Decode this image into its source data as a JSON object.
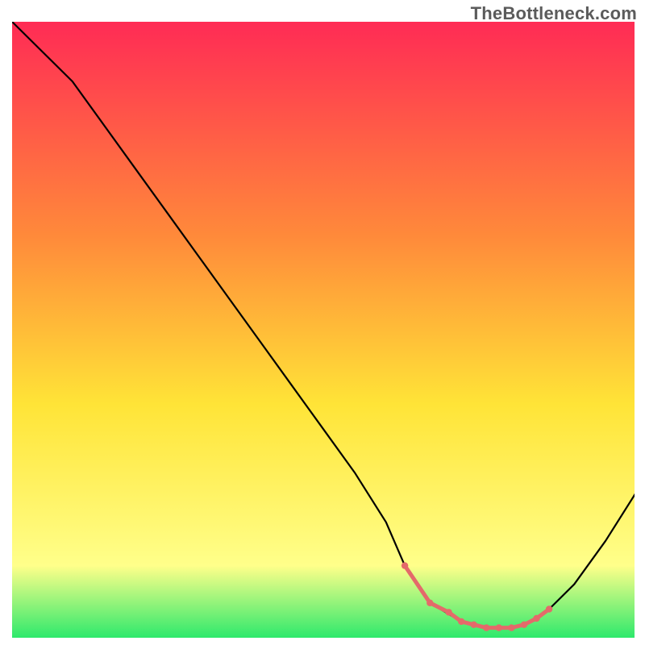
{
  "watermark": "TheBottleneck.com",
  "chart_data": {
    "type": "line",
    "title": "",
    "xlabel": "",
    "ylabel": "",
    "xlim": [
      0,
      100
    ],
    "ylim": [
      0,
      100
    ],
    "series": [
      {
        "name": "bottleneck-curve",
        "x": [
          0,
          5,
          10,
          15,
          20,
          25,
          30,
          35,
          40,
          45,
          50,
          55,
          60,
          63,
          67,
          72,
          76,
          80,
          83,
          86,
          90,
          95,
          100
        ],
        "y": [
          100,
          95,
          90,
          83,
          76,
          69,
          62,
          55,
          48,
          41,
          34,
          27,
          19,
          12,
          6,
          3,
          2,
          2,
          3,
          5,
          9,
          16,
          24
        ]
      }
    ],
    "control_points": {
      "name": "highlighted-range",
      "x": [
        63,
        67,
        70,
        72,
        74,
        76,
        78,
        80,
        82,
        84,
        86
      ],
      "y": [
        12,
        6,
        4.5,
        3,
        2.5,
        2,
        2,
        2,
        2.5,
        3.5,
        5
      ]
    },
    "gradient_background": {
      "top": "#ff2a55",
      "mid1": "#ff8a3a",
      "mid2": "#ffe437",
      "low": "#ffff8a",
      "bottom": "#27e86b"
    }
  }
}
